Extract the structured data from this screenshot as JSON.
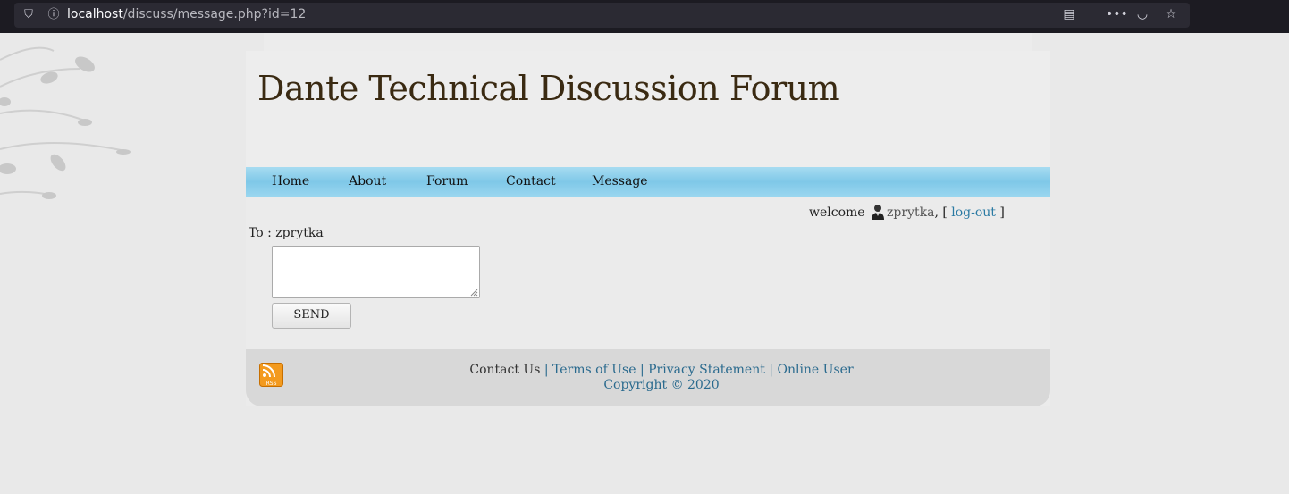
{
  "browser": {
    "url_host": "localhost",
    "url_path": "/discuss/message.php?id=12"
  },
  "site": {
    "title": "Dante Technical Discussion Forum"
  },
  "nav": {
    "items": [
      "Home",
      "About",
      "Forum",
      "Contact",
      "Message"
    ]
  },
  "welcome": {
    "prefix": "welcome",
    "username": "zprytka",
    "sep_open": ", [",
    "logout": "log-out",
    "sep_close": "]"
  },
  "message_form": {
    "to_label": "To : zprytka",
    "message_value": "",
    "send_label": "SEND"
  },
  "footer": {
    "contact": "Contact Us",
    "terms": "Terms of Use",
    "privacy": "Privacy Statement",
    "online": "Online User",
    "copyright": "Copyright © 2020",
    "rss_label": "RSS"
  },
  "colors": {
    "nav_bg": "#8ccfee",
    "title": "#3a2a12",
    "link": "#2a6a8e"
  }
}
